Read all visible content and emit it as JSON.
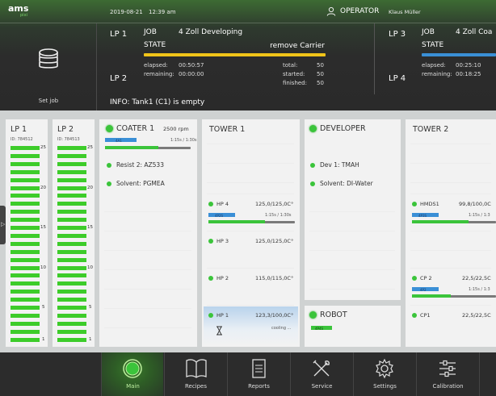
{
  "header": {
    "logo": "ams",
    "logo_sub": "pixi",
    "date": "2019-08-21",
    "time": "12:39 am",
    "role": "OPERATOR",
    "user": "Klaus Müller"
  },
  "set_job_label": "Set job",
  "lp1": {
    "name": "LP 1",
    "job_label": "JOB",
    "job_value": "4 Zoll Developing",
    "state_label": "STATE",
    "state_value": "remove Carrier",
    "state_color": "#f0c419",
    "elapsed_label": "elapsed:",
    "elapsed": "00:50:57",
    "remaining_label": "remaining:",
    "remaining": "00:00:00",
    "total_label": "total:",
    "total": "50",
    "started_label": "started:",
    "started": "50",
    "finished_label": "finished:",
    "finished": "50"
  },
  "lp2_label": "LP 2",
  "lp3": {
    "name": "LP 3",
    "job_label": "JOB",
    "job_value": "4 Zoll Coa",
    "state_label": "STATE",
    "state_color": "#3a8fd6",
    "elapsed_label": "elapsed:",
    "elapsed": "00:25:10",
    "remaining_label": "remaining:",
    "remaining": "00:18:25"
  },
  "lp4_label": "LP 4",
  "info": "INFO: Tank1 (C1) is empty",
  "lp_panels": [
    {
      "title": "LP 1",
      "id": "ID: 784512"
    },
    {
      "title": "LP 2",
      "id": "ID: 784513"
    }
  ],
  "slot_numbers": [
    "25",
    "20",
    "15",
    "10",
    "5",
    "1"
  ],
  "coater": {
    "title": "COATER 1",
    "rpm": "2500 rpm",
    "tag": "4A1",
    "time": "1:15s / 1:30s",
    "resist": "Resist 2:  AZ533",
    "solvent": "Solvent:  PGMEA"
  },
  "tower1": {
    "title": "TOWER 1",
    "items": [
      {
        "name": "HP 4",
        "value": "125,0/125,0C°",
        "tag": "4P2S",
        "time": "1:15s / 1:30s"
      },
      {
        "name": "HP 3",
        "value": "125,0/125,0C°"
      },
      {
        "name": "HP 2",
        "value": "115,0/115,0C°"
      },
      {
        "name": "HP 1",
        "value": "123,3/100,0C°",
        "status": "cooling ..."
      }
    ]
  },
  "developer": {
    "title": "DEVELOPER",
    "dev": "Dev 1:  TMAH",
    "solvent": "Solvent:  DI-Water"
  },
  "robot": {
    "title": "ROBOT",
    "tag": "4P4S"
  },
  "tower2": {
    "title": "TOWER 2",
    "items": [
      {
        "name": "HMDS1",
        "value": "99,8/100,0C",
        "tag": "4P3S",
        "time": "1:15s / 1:3"
      },
      {
        "name": "CP 2",
        "value": "22,5/22,5C",
        "tag": "4P2",
        "time": "1:15s / 1:3"
      },
      {
        "name": "CP1",
        "value": "22,5/22,5C"
      }
    ]
  },
  "nav": [
    {
      "label": "Main",
      "icon": "main-icon",
      "active": true
    },
    {
      "label": "Recipes",
      "icon": "book-icon"
    },
    {
      "label": "Reports",
      "icon": "document-icon"
    },
    {
      "label": "Service",
      "icon": "tools-icon"
    },
    {
      "label": "Settings",
      "icon": "gear-icon"
    },
    {
      "label": "Calibration",
      "icon": "sliders-icon"
    }
  ],
  "colors": {
    "accent_green": "#3bc43b",
    "progress_blue": "#3a8fd6",
    "state_yellow": "#f0c419"
  }
}
